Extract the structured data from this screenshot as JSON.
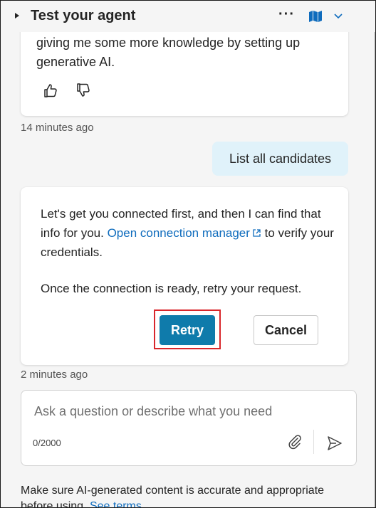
{
  "header": {
    "title": "Test your agent",
    "more_label": "···",
    "icons": [
      "expand-caret-icon",
      "more-icon",
      "map-icon",
      "chevron-down-icon"
    ]
  },
  "messages": {
    "bot1": {
      "text": "giving me some more knowledge by setting up generative AI.",
      "timestamp": "14 minutes ago"
    },
    "user": {
      "text": "List all candidates"
    },
    "bot2": {
      "line1": "Let's get you connected first, and then I can find that info for you.",
      "link_text": "Open connection manager",
      "line1_tail": "to verify your credentials.",
      "line2": "Once the connection is ready, retry your request.",
      "retry_label": "Retry",
      "cancel_label": "Cancel",
      "timestamp": "2 minutes ago"
    }
  },
  "composer": {
    "placeholder": "Ask a question or describe what you need",
    "value": "",
    "counter": "0/2000"
  },
  "footer": {
    "text": "Make sure AI-generated content is accurate and appropriate before using.",
    "link": "See terms"
  },
  "colors": {
    "accent": "#0f7bab",
    "link": "#0f6cbd",
    "highlight": "#d9262b",
    "user_bubble": "#e0f2fa"
  }
}
